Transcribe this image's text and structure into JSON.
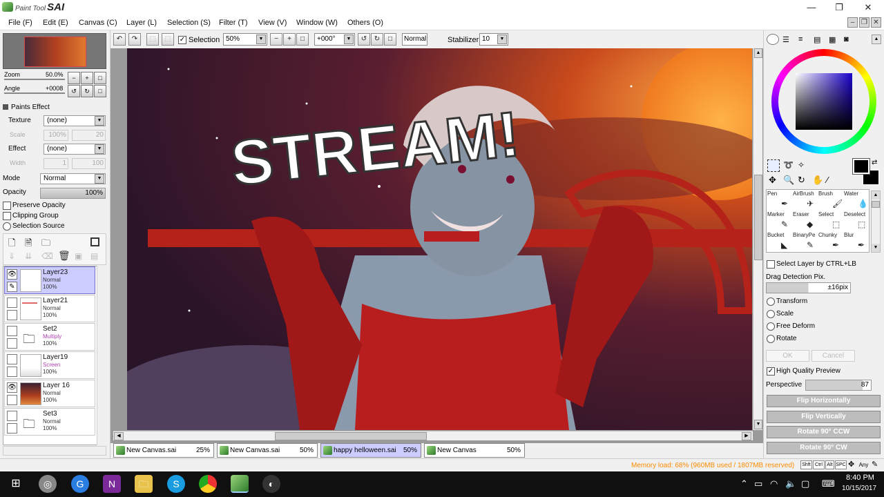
{
  "app": {
    "name_prefix": "Paint Tool",
    "name": "SAI"
  },
  "window_controls": {
    "minimize": "—",
    "maximize": "❐",
    "close": "✕"
  },
  "menu": [
    "File (F)",
    "Edit (E)",
    "Canvas (C)",
    "Layer (L)",
    "Selection (S)",
    "Filter (T)",
    "View (V)",
    "Window (W)",
    "Others (O)"
  ],
  "toolbar": {
    "selection_label": "Selection",
    "zoom_value": "50%",
    "angle_value": "+000°",
    "blend_mode": "Normal",
    "stabilizer_label": "Stabilizer",
    "stabilizer_value": "10"
  },
  "navigator": {
    "zoom_label": "Zoom",
    "zoom_value": "50.0%",
    "angle_label": "Angle",
    "angle_value": "+0008"
  },
  "paints_effect": {
    "title": "Paints Effect",
    "texture_label": "Texture",
    "texture_value": "(none)",
    "scale_label": "Scale",
    "scale_value": "100%",
    "scale_num": "20",
    "effect_label": "Effect",
    "effect_value": "(none)",
    "width_label": "Width",
    "width_value": "1",
    "width_num": "100"
  },
  "layer_props": {
    "mode_label": "Mode",
    "mode_value": "Normal",
    "opacity_label": "Opacity",
    "opacity_value": "100%",
    "preserve_opacity": "Preserve Opacity",
    "clipping_group": "Clipping Group",
    "selection_source": "Selection Source"
  },
  "layers": [
    {
      "name": "Layer23",
      "mode": "Normal",
      "opacity": "100%",
      "selected": true
    },
    {
      "name": "Layer21",
      "mode": "Normal",
      "opacity": "100%",
      "selected": false
    },
    {
      "name": "Set2",
      "mode": "Multiply",
      "opacity": "100%",
      "selected": false
    },
    {
      "name": "Layer19",
      "mode": "Screen",
      "opacity": "100%",
      "selected": false
    },
    {
      "name": "Layer 16",
      "mode": "Normal",
      "opacity": "100%",
      "selected": false
    },
    {
      "name": "Set3",
      "mode": "Normal",
      "opacity": "100%",
      "selected": false
    }
  ],
  "canvas": {
    "stream_text": "STREAM!"
  },
  "doc_tabs": [
    {
      "name": "New Canvas.sai",
      "zoom": "25%"
    },
    {
      "name": "New Canvas.sai",
      "zoom": "50%"
    },
    {
      "name": "happy helloween.sai",
      "zoom": "50%"
    },
    {
      "name": "New Canvas",
      "zoom": "50%"
    }
  ],
  "tools": [
    {
      "label": "Pen",
      "glyph": "✒"
    },
    {
      "label": "AirBrush",
      "glyph": "✈"
    },
    {
      "label": "Brush",
      "glyph": "🖌"
    },
    {
      "label": "Water",
      "glyph": "💧"
    },
    {
      "label": "Marker",
      "glyph": "✎"
    },
    {
      "label": "Eraser",
      "glyph": "◆"
    },
    {
      "label": "Select",
      "glyph": "⬚"
    },
    {
      "label": "Deselect",
      "glyph": "⬚"
    },
    {
      "label": "Bucket",
      "glyph": "◣"
    },
    {
      "label": "BinaryPe",
      "glyph": "✎"
    },
    {
      "label": "Chunky",
      "glyph": "✒"
    },
    {
      "label": "Blur",
      "glyph": "✒"
    }
  ],
  "right_panel": {
    "select_layer_ctrl": "Select Layer by CTRL+LB",
    "drag_detection_label": "Drag Detection Pix.",
    "drag_detection_value": "±16pix",
    "transform_options": [
      "Transform",
      "Scale",
      "Free Deform",
      "Rotate"
    ],
    "ok": "OK",
    "cancel": "Cancel",
    "hq_preview": "High Quality Preview",
    "perspective_label": "Perspective",
    "perspective_value": "87",
    "flip_h": "Flip Horizontally",
    "flip_v": "Flip Vertically",
    "rot_ccw": "Rotate 90° CCW",
    "rot_cw": "Rotate 90° CW"
  },
  "status": {
    "memory": "Memory load: 68% (960MB used / 1807MB reserved)",
    "keys": [
      "Shft",
      "Ctrl",
      "Alt",
      "SPC",
      "Any"
    ]
  },
  "colors": {
    "accent_orange": "#ff8c00",
    "selected_layer": "#ccccff",
    "primary_color": "#000000"
  },
  "taskbar": {
    "time": "8:40 PM",
    "date": "10/15/2017"
  }
}
